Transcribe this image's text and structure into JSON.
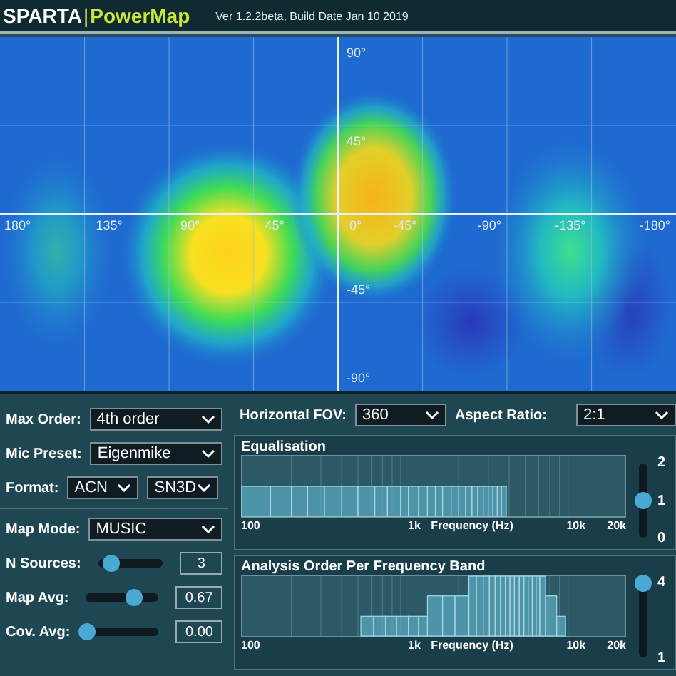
{
  "header": {
    "brand": "SPARTA",
    "separator": "|",
    "product": "PowerMap",
    "version": "Ver 1.2.2beta, Build Date Jan 10 2019"
  },
  "map": {
    "azimuth_labels": [
      "180°",
      "135°",
      "90°",
      "45°",
      "0°",
      "-45°",
      "-90°",
      "-135°",
      "-180°"
    ],
    "elevation_labels": [
      "90°",
      "45°",
      "-45°",
      "-90°"
    ]
  },
  "input_settings": [
    {
      "kind": "dropdown",
      "label": "Max Order:",
      "value": "4th order"
    },
    {
      "kind": "dropdown",
      "label": "Mic Preset:",
      "value": "Eigenmike"
    },
    {
      "kind": "pair",
      "label": "Format:",
      "values": [
        "ACN",
        "SN3D"
      ]
    }
  ],
  "map_settings": [
    {
      "kind": "dropdown",
      "label": "Map Mode:",
      "value": "MUSIC"
    },
    {
      "kind": "slider",
      "label": "N Sources:",
      "level": 0.2,
      "value": "3"
    },
    {
      "kind": "slider",
      "label": "Map Avg:",
      "level": 0.67,
      "value": "0.67"
    },
    {
      "kind": "slider",
      "label": "Cov. Avg:",
      "level": 0,
      "value": "0.00"
    }
  ],
  "display": [
    {
      "label": "Horizontal FOV:",
      "value": "360"
    },
    {
      "label": "Aspect Ratio:",
      "value": "2:1"
    }
  ],
  "graphs": [
    {
      "kind": "equalisation",
      "title": "Equalisation",
      "x_labels": [
        "100",
        "1k",
        "Frequency (Hz)",
        "10k",
        "20k"
      ],
      "slider_labels": [
        "2",
        "1",
        "0"
      ],
      "level": 0.5
    },
    {
      "kind": "order",
      "title": "Analysis Order Per Frequency Band",
      "x_labels": [
        "100",
        "1k",
        "Frequency (Hz)",
        "10k",
        "20k"
      ],
      "slider_labels": [
        "4",
        "1"
      ],
      "level": 1
    }
  ]
}
